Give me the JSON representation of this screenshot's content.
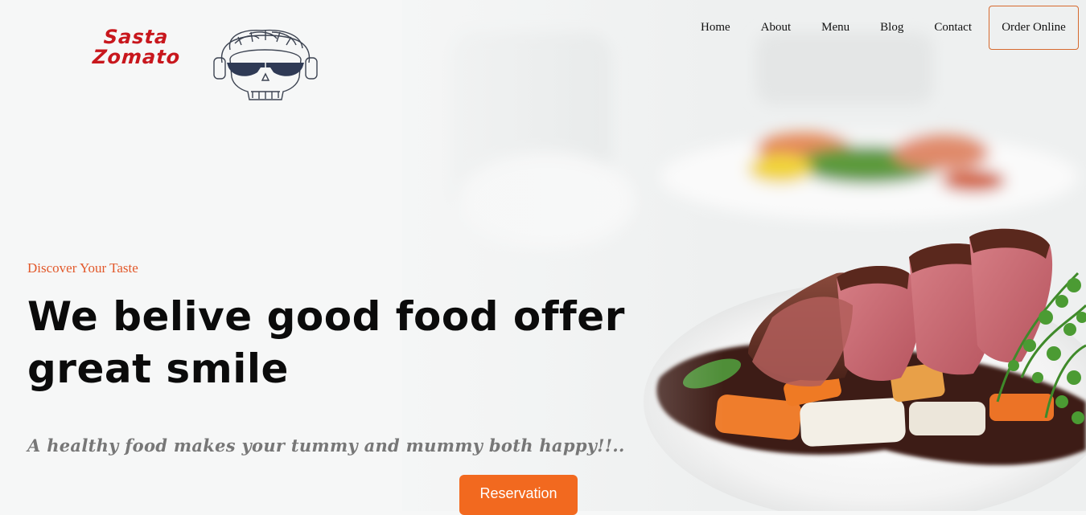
{
  "brand": {
    "line1": "Sasta",
    "line2": "Zomato",
    "color": "#c8171d"
  },
  "nav": {
    "items": [
      {
        "label": "Home"
      },
      {
        "label": "About"
      },
      {
        "label": "Menu"
      },
      {
        "label": "Blog"
      },
      {
        "label": "Contact"
      }
    ],
    "order_label": "Order Online",
    "accent": "#d6692e"
  },
  "hero": {
    "eyebrow": "Discover Your Taste",
    "headline": "We belive good food offer great smile",
    "tagline": "A healthy food makes your tummy and mummy both happy!!..",
    "cta_label": "Reservation",
    "cta_color": "#f2691f",
    "image": "plated-steak-vegetables"
  }
}
